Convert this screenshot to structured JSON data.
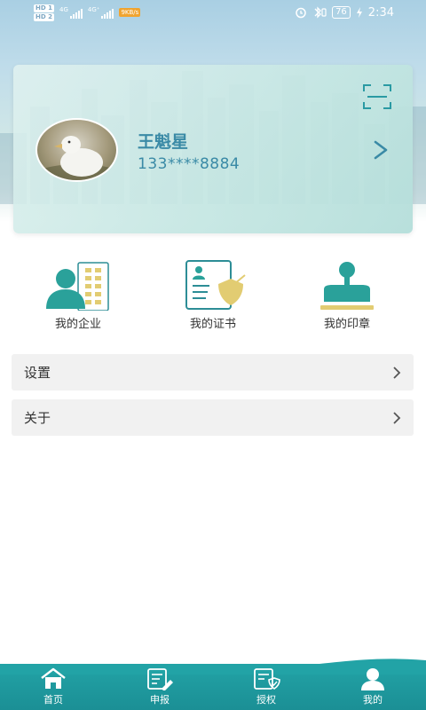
{
  "status_bar": {
    "hd1": "HD 1",
    "hd2": "HD 2",
    "net1": "4G",
    "net2": "4G⁺",
    "speed": "9KB/s",
    "battery": "76",
    "time": "2:34"
  },
  "profile": {
    "name": "王魁星",
    "phone": "133****8884"
  },
  "actions": [
    {
      "label": "我的企业",
      "icon": "enterprise-icon"
    },
    {
      "label": "我的证书",
      "icon": "certificate-icon"
    },
    {
      "label": "我的印章",
      "icon": "seal-icon"
    }
  ],
  "menu": [
    {
      "label": "设置"
    },
    {
      "label": "关于"
    }
  ],
  "bottom_nav": [
    {
      "label": "首页",
      "icon": "home-icon"
    },
    {
      "label": "申报",
      "icon": "declare-icon"
    },
    {
      "label": "授权",
      "icon": "authorize-icon"
    },
    {
      "label": "我的",
      "icon": "user-icon",
      "active": true
    }
  ],
  "colors": {
    "accent": "#3a8aa6",
    "nav_bg": "#1b8f95",
    "teal_icon": "#2aa19a",
    "gold_icon": "#e2cc72"
  }
}
